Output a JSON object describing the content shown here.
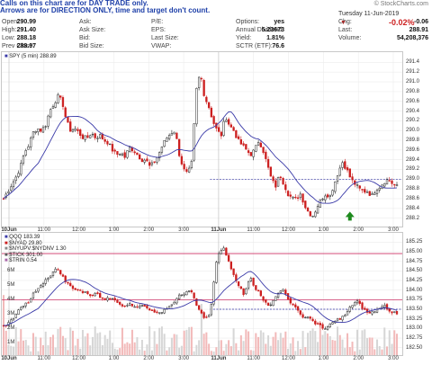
{
  "banner": {
    "line1": "Calls on this chart are for DAY TRADE only.",
    "line2": "Arrows are for DIRECTION ONLY, time and target don't count."
  },
  "site": "© StockCharts.com",
  "quote": {
    "date": "Tuesday  11-Jun-2019",
    "chg_pct": "-0.02%",
    "rows": [
      [
        "Open:",
        "290.99",
        "Ask:",
        "",
        "P/E:",
        "",
        "Options:",
        "yes",
        "Chg:",
        "-0.06"
      ],
      [
        "High:",
        "291.40",
        "Ask Size:",
        "",
        "EPS:",
        "",
        "Annual Dividend:",
        "5.23673",
        "Last:",
        "288.91"
      ],
      [
        "Low:",
        "288.18",
        "Bid:",
        "",
        "Last Size:",
        "",
        "Yield:",
        "1.81%",
        "Volume:",
        "54,208,376"
      ],
      [
        "Prev Close:",
        "288.97",
        "Bid Size:",
        "",
        "VWAP:",
        "",
        "SCTR (ETF):",
        "76.6",
        "",
        ""
      ]
    ]
  },
  "top_legend": "SPY (5 min) 288.89",
  "bottom_legend": [
    "QQQ 183.39",
    "$NYAD 29.80",
    "$NYUPV:$NYDNV 1.30",
    "$TICK 301.00",
    "$TRIN 0.54"
  ],
  "colors": {
    "up": "#222222",
    "down": "#cc1f1f",
    "ma": "#3a3aa8",
    "arrow": "#1e8a1e",
    "hline": "#cc3366"
  },
  "chart_data": [
    {
      "type": "candlestick",
      "title": "SPY (5 min) 288.89",
      "y_ticks": [
        288.2,
        288.4,
        288.6,
        288.8,
        289.0,
        289.2,
        289.4,
        289.6,
        289.8,
        290.0,
        290.2,
        290.4,
        290.6,
        290.8,
        291.0,
        291.2,
        291.4
      ],
      "ylim": [
        288.1,
        291.5
      ],
      "x_tick_labels": [
        "10Jun",
        "11:00",
        "12:00",
        "1:00",
        "2:00",
        "3:00",
        "11Jun",
        "11:00",
        "12:00",
        "1:00",
        "2:00",
        "3:00"
      ],
      "closes_path": [
        288.6,
        288.75,
        288.9,
        289.05,
        289.25,
        289.55,
        289.7,
        289.95,
        290.05,
        290.0,
        290.1,
        290.4,
        290.55,
        290.7,
        290.6,
        290.2,
        290.0,
        290.05,
        289.95,
        289.85,
        289.85,
        289.95,
        289.85,
        289.9,
        289.8,
        289.75,
        289.6,
        289.5,
        289.55,
        289.45,
        289.65,
        289.6,
        289.5,
        289.4,
        289.4,
        289.25,
        289.35,
        289.5,
        289.7,
        289.85,
        289.95,
        290.0,
        289.5,
        289.2,
        289.1,
        289.35,
        290.8,
        291.2,
        290.7,
        290.5,
        290.2,
        290.0,
        289.9,
        290.3,
        290.1,
        290.0,
        289.8,
        289.7,
        289.6,
        289.5,
        289.6,
        289.8,
        289.6,
        289.3,
        289.0,
        288.85,
        289.1,
        288.9,
        288.7,
        288.6,
        288.6,
        288.7,
        288.45,
        288.3,
        288.25,
        288.45,
        288.6,
        288.7,
        288.65,
        288.9,
        289.15,
        289.35,
        289.2,
        289.0,
        288.9,
        288.8,
        288.75,
        288.75,
        288.65,
        288.8,
        288.85,
        288.95,
        289.0,
        288.9,
        288.85
      ],
      "dashed_level": 289.0,
      "annotation": "green up arrow near 2:00-3:00 on 11Jun"
    },
    {
      "type": "candlestick",
      "title": "QQQ 183.39",
      "y_ticks": [
        182.5,
        182.75,
        183.0,
        183.25,
        183.5,
        183.75,
        184.0,
        184.25,
        184.5,
        184.75,
        185.0,
        185.25
      ],
      "ylim": [
        182.4,
        185.35
      ],
      "volume_ticks": [
        "1M",
        "2M",
        "3M",
        "4M",
        "5M",
        "6M"
      ],
      "x_tick_labels": [
        "10Jun",
        "11:00",
        "12:00",
        "1:00",
        "2:00",
        "3:00",
        "11Jun",
        "11:00",
        "12:00",
        "1:00",
        "2:00",
        "3:00"
      ],
      "solid_levels": [
        184.95,
        183.75
      ],
      "dashed_level": 183.5
    }
  ]
}
